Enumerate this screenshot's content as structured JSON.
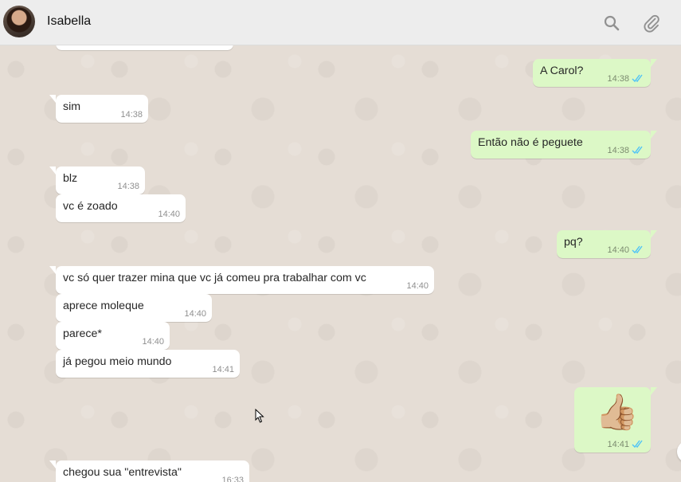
{
  "header": {
    "contact_name": "Isabella",
    "icons": [
      "search-icon",
      "paperclip-icon"
    ]
  },
  "messages": [
    {
      "direction": "out",
      "text": "A Carol?",
      "time": "14:38",
      "status": "read"
    },
    {
      "direction": "in",
      "text": "sim",
      "time": "14:38"
    },
    {
      "direction": "out",
      "text": "Então não é peguete",
      "time": "14:38",
      "status": "read"
    },
    {
      "direction": "in",
      "text": "blz",
      "time": "14:38"
    },
    {
      "direction": "in",
      "text": "vc é zoado",
      "time": "14:40"
    },
    {
      "direction": "out",
      "text": "pq?",
      "time": "14:40",
      "status": "read"
    },
    {
      "direction": "in",
      "text": "vc só quer trazer mina que vc já comeu pra trabalhar com vc",
      "time": "14:40"
    },
    {
      "direction": "in",
      "text": "aprece moleque",
      "time": "14:40"
    },
    {
      "direction": "in",
      "text": "parece*",
      "time": "14:40"
    },
    {
      "direction": "in",
      "text": "já pegou meio mundo",
      "time": "14:41"
    },
    {
      "direction": "out",
      "text": "👍🏼",
      "time": "14:41",
      "status": "read",
      "emoji": true
    },
    {
      "direction": "in",
      "text": "chegou sua \"entrevista\"",
      "time": "16:33"
    }
  ],
  "colors": {
    "incoming_bubble": "#ffffff",
    "outgoing_bubble": "#dcf8c6",
    "chat_background": "#e5ddd5",
    "read_ticks": "#4fc3f7"
  }
}
